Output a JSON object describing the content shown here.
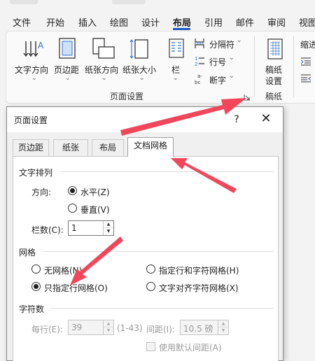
{
  "ribbon_tabs": [
    "文件",
    "开始",
    "插入",
    "绘图",
    "设计",
    "布局",
    "引用",
    "邮件",
    "审阅",
    "视图"
  ],
  "ribbon": {
    "text_direction": "文字方向",
    "margins": "页边距",
    "orientation": "纸张方向",
    "size": "纸张大小",
    "columns": "栏",
    "breaks": "分隔符",
    "line_numbers": "行号",
    "hyphenation": "断字",
    "page_setup_group": "页面设置",
    "manuscript_setting_line1": "稿纸",
    "manuscript_setting_line2": "设置",
    "manuscript_group": "稿纸",
    "indent": "缩进"
  },
  "dialog": {
    "title": "页面设置",
    "help": "?",
    "close": "✕",
    "tabs": [
      "页边距",
      "纸张",
      "布局",
      "文档网格"
    ],
    "text_flow_section": "文字排列",
    "direction_label": "方向:",
    "horizontal": "水平(Z)",
    "vertical": "垂直(V)",
    "columns_label": "栏数(C):",
    "columns_value": "1",
    "grid_section": "网格",
    "no_grid": "无网格(N)",
    "specify_line_and_char": "指定行和字符网格(H)",
    "specify_line_only": "只指定行网格(O)",
    "snap_to_char": "文字对齐字符网格(X)",
    "chars_section": "字符数",
    "per_line_label": "每行(E):",
    "per_line_value": "39",
    "per_line_range": "(1-43)",
    "pitch_label": "间距(I):",
    "pitch_value": "10.5 磅",
    "use_default_pitch": "使用默认间距(A)"
  }
}
